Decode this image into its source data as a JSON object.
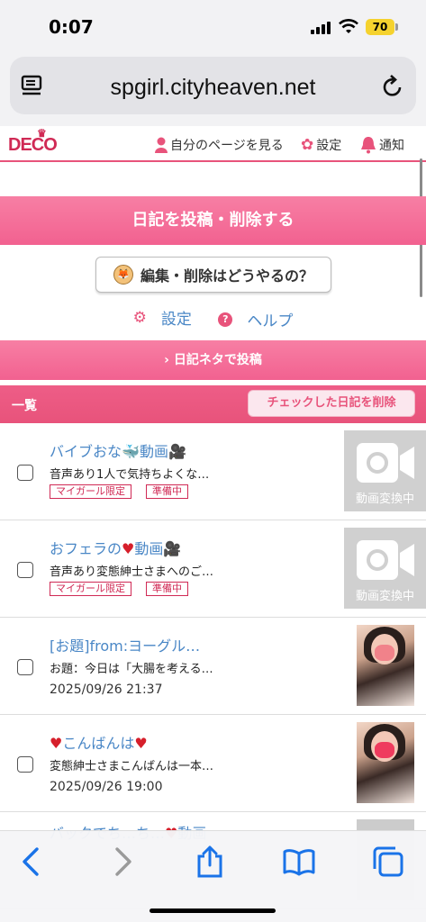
{
  "status": {
    "time": "0:07",
    "battery": "70"
  },
  "browser": {
    "url": "spgirl.cityheaven.net"
  },
  "header": {
    "logo": "DECO",
    "my_page": "自分のページを見る",
    "settings": "設定",
    "notifications": "通知"
  },
  "actions": {
    "post_label": "日記を投稿・削除する",
    "howto_label": "編集・削除はどうやるの？",
    "settings_link": "設定",
    "help_link": "ヘルプ",
    "neta_label": "日記ネタで投稿"
  },
  "list": {
    "title": "一覧",
    "delete_checked": "チェックした日記を削除",
    "rows": [
      {
        "title_pre": "バイブおな",
        "title_post": "動画",
        "snippet": "音声あり1人で気持ちよくな…",
        "tags": [
          "マイガール限定",
          "準備中"
        ],
        "thumb_label": "動画変換中"
      },
      {
        "title_pre": "おフェラの",
        "title_post": "動画",
        "snippet": "音声あり変態紳士さまへのご…",
        "tags": [
          "マイガール限定",
          "準備中"
        ],
        "thumb_label": "動画変換中"
      },
      {
        "title": "[お題]from:ヨーグル…",
        "snippet": "お題：今日は「大腸を考える…",
        "date": "2025/09/26 21:37"
      },
      {
        "title": "こんばんは",
        "snippet": "変態紳士さまこんばんは一本…",
        "date": "2025/09/26 19:00"
      },
      {
        "title": "バックでち…ち…",
        "title_post": "動画"
      }
    ]
  },
  "icons": {
    "heart": "♥",
    "camera": "🎥",
    "whale": "🐳"
  }
}
